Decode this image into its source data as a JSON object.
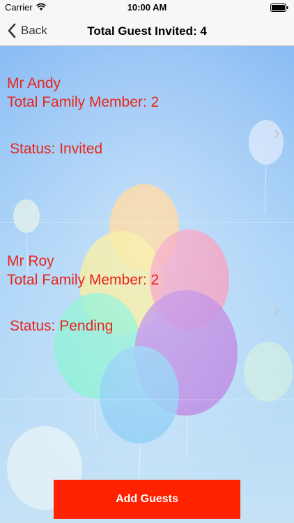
{
  "status_bar": {
    "carrier": "Carrier",
    "time": "10:00 AM"
  },
  "nav": {
    "back_label": "Back",
    "title": "Total Guest Invited: 4"
  },
  "guests": [
    {
      "name": "Mr Andy",
      "family": "Total Family Member: 2",
      "status": "Status: Invited"
    },
    {
      "name": "Mr Roy",
      "family": "Total Family Member: 2",
      "status": "Status: Pending"
    }
  ],
  "add_button_label": "Add Guests",
  "colors": {
    "accent": "#ff2200",
    "text_red": "#e8241b",
    "background": "#8fc0f5"
  },
  "icons": [
    "wifi-icon",
    "battery-icon",
    "back-chevron-icon",
    "chevron-right-icon"
  ]
}
